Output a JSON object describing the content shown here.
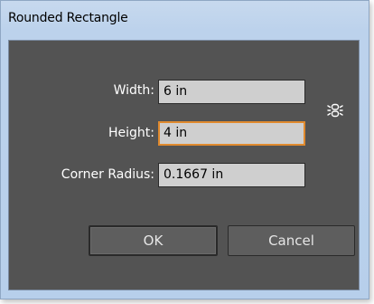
{
  "window": {
    "title": "Rounded Rectangle"
  },
  "form": {
    "width": {
      "label": "Width:",
      "value": "6 in"
    },
    "height": {
      "label": "Height:",
      "value": "4 in"
    },
    "corner_radius": {
      "label": "Corner Radius:",
      "value": "0.1667 in"
    }
  },
  "constrain_icon": "link-constrain-icon",
  "buttons": {
    "ok": "OK",
    "cancel": "Cancel"
  },
  "colors": {
    "panel": "#535353",
    "field": "#cfcfcf",
    "focus": "#e08a2e"
  }
}
